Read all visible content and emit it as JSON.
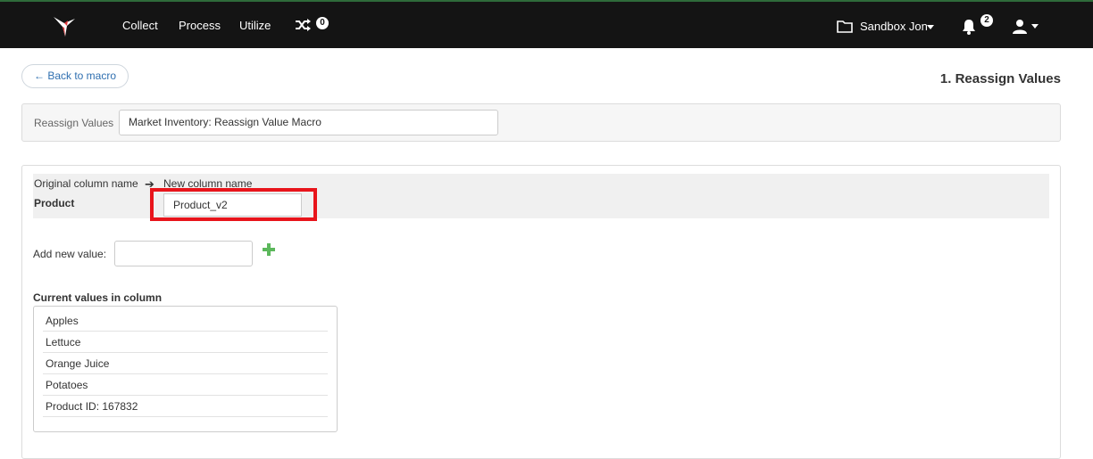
{
  "nav": {
    "items": [
      {
        "label": "Collect"
      },
      {
        "label": "Process"
      },
      {
        "label": "Utilize"
      }
    ],
    "shuffle_count": "0",
    "workspace": "Sandbox Jon",
    "notification_count": "2"
  },
  "header": {
    "back_label": "← Back to macro",
    "step_title": "1. Reassign Values"
  },
  "macro": {
    "label": "Reassign Values",
    "value": "Market Inventory: Reassign Value Macro"
  },
  "mapping": {
    "original_header": "Original column name",
    "new_header": "New column name",
    "original_value": "Product",
    "new_value": "Product_v2"
  },
  "add_value": {
    "label": "Add new value:",
    "value": ""
  },
  "current_values": {
    "label": "Current values in column",
    "items": [
      "Apples",
      "Lettuce",
      "Orange Juice",
      "Potatoes",
      "Product ID: 167832"
    ]
  },
  "colors": {
    "topbar": "#141414",
    "accent_link": "#2f6fb0",
    "highlight": "#e8141b",
    "add_icon": "#5cb85c"
  }
}
